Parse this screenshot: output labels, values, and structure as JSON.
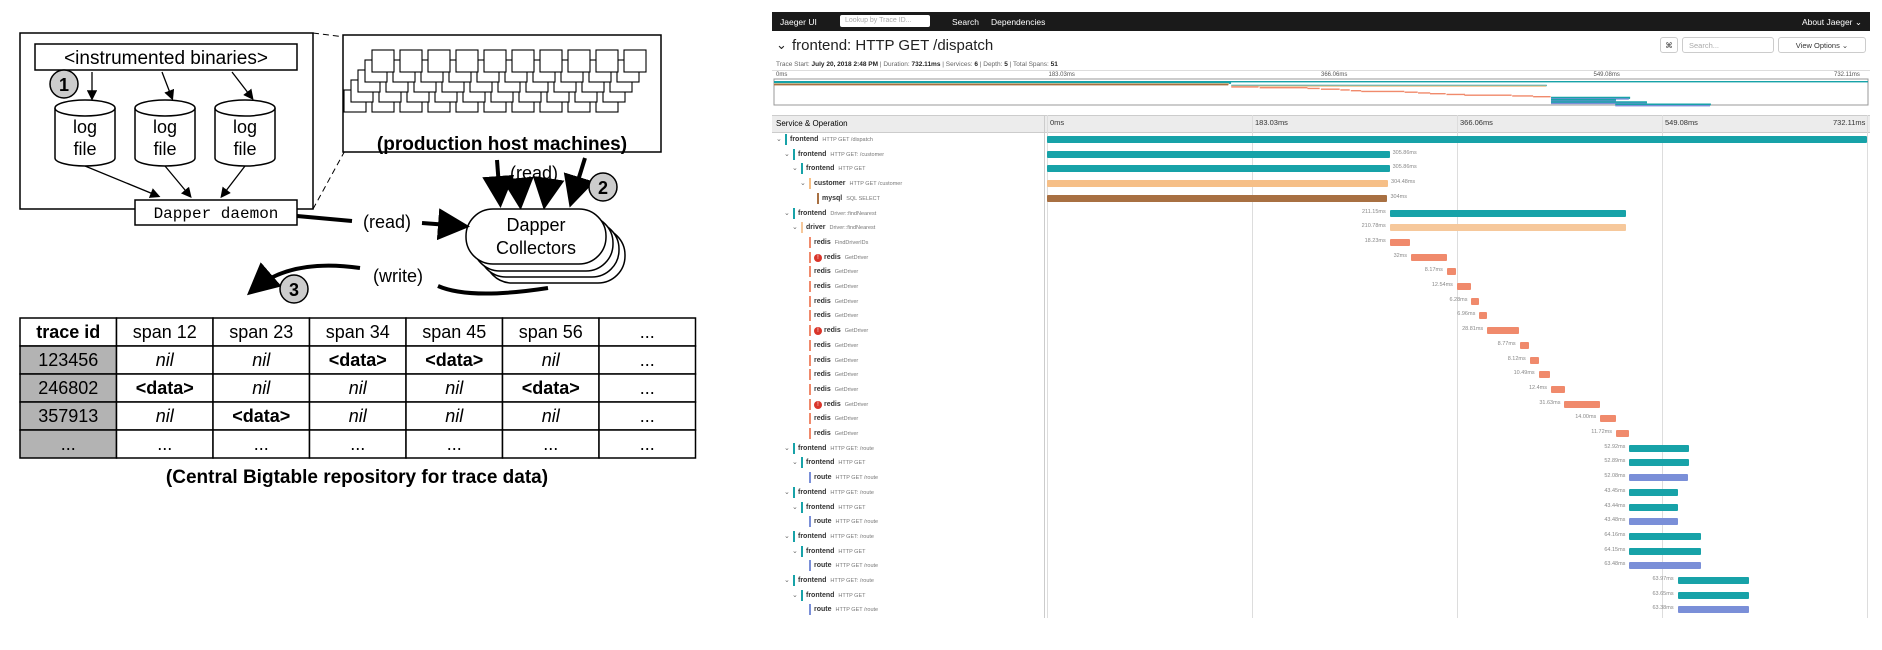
{
  "dapper": {
    "binaries_label": "<instrumented binaries>",
    "log_file_labels": [
      "log",
      "file"
    ],
    "step1": "1",
    "step2": "2",
    "step3": "3",
    "daemon_label": "Dapper daemon",
    "hosts_caption": "(production host machines)",
    "read_top": "(read)",
    "read_mid": "(read)",
    "write_label": "(write)",
    "collectors_line1": "Dapper",
    "collectors_line2": "Collectors",
    "table": {
      "headers": [
        "trace id",
        "span 12",
        "span 23",
        "span 34",
        "span 45",
        "span 56",
        "..."
      ],
      "rows": [
        [
          "123456",
          "nil",
          "nil",
          "<data>",
          "<data>",
          "nil",
          "..."
        ],
        [
          "246802",
          "<data>",
          "nil",
          "nil",
          "nil",
          "<data>",
          "..."
        ],
        [
          "357913",
          "nil",
          "<data>",
          "nil",
          "nil",
          "nil",
          "..."
        ],
        [
          "...",
          "...",
          "...",
          "...",
          "...",
          "...",
          "..."
        ]
      ]
    },
    "caption": "(Central Bigtable repository for trace data)"
  },
  "jaeger": {
    "brand": "Jaeger UI",
    "search_placeholder": "Lookup by Trace ID...",
    "nav": [
      "Search",
      "Dependencies"
    ],
    "about": "About Jaeger ⌄",
    "trace_title": "frontend: HTTP GET /dispatch",
    "meta": {
      "trace_start_label": "Trace Start:",
      "trace_start": "July 20, 2018 2:48 PM",
      "duration_label": "Duration:",
      "duration": "732.11ms",
      "services_label": "Services:",
      "services": "6",
      "depth_label": "Depth:",
      "depth": "5",
      "spans_label": "Total Spans:",
      "spans": "51"
    },
    "find_placeholder": "Search...",
    "view_options": "View Options ⌄",
    "ticks": [
      "0ms",
      "183.03ms",
      "366.06ms",
      "549.08ms",
      "732.11ms"
    ],
    "col_title": "Service & Operation",
    "total_ms": 732.11,
    "colors": {
      "frontend": "#17a2a8",
      "customer": "#f6bf87",
      "mysql": "#a87042",
      "driver": "#f6c89b",
      "redis": "#f08a6c",
      "route": "#7a8fd8"
    },
    "spans": [
      {
        "svc": "frontend",
        "op": "HTTP GET /dispatch",
        "lvl": 0,
        "caret": true,
        "start": 0,
        "dur": 732.11,
        "label": ""
      },
      {
        "svc": "frontend",
        "op": "HTTP GET: /customer",
        "lvl": 1,
        "caret": true,
        "start": 0,
        "dur": 305.86,
        "label": "305.86ms"
      },
      {
        "svc": "frontend",
        "op": "HTTP GET",
        "lvl": 2,
        "caret": true,
        "start": 0,
        "dur": 305.86,
        "label": "305.86ms"
      },
      {
        "svc": "customer",
        "op": "HTTP GET /customer",
        "lvl": 3,
        "caret": true,
        "start": 0,
        "dur": 304.48,
        "label": "304.48ms"
      },
      {
        "svc": "mysql",
        "op": "SQL SELECT",
        "lvl": 4,
        "caret": false,
        "start": 0,
        "dur": 304,
        "label": "304ms"
      },
      {
        "svc": "frontend",
        "op": "Driver::findNearest",
        "lvl": 1,
        "caret": true,
        "start": 306,
        "dur": 211.15,
        "label": "211.15ms"
      },
      {
        "svc": "driver",
        "op": "Driver::findNearest",
        "lvl": 2,
        "caret": true,
        "start": 306,
        "dur": 210.78,
        "label": "210.78ms"
      },
      {
        "svc": "redis",
        "op": "FindDriverIDs",
        "lvl": 3,
        "caret": false,
        "start": 306,
        "dur": 18.23,
        "label": "18.23ms"
      },
      {
        "svc": "redis",
        "op": "GetDriver",
        "lvl": 3,
        "caret": false,
        "err": true,
        "start": 325,
        "dur": 32,
        "label": "32ms"
      },
      {
        "svc": "redis",
        "op": "GetDriver",
        "lvl": 3,
        "caret": false,
        "start": 357,
        "dur": 8.17,
        "label": "8.17ms"
      },
      {
        "svc": "redis",
        "op": "GetDriver",
        "lvl": 3,
        "caret": false,
        "start": 366,
        "dur": 12.54,
        "label": "12.54ms"
      },
      {
        "svc": "redis",
        "op": "GetDriver",
        "lvl": 3,
        "caret": false,
        "start": 379,
        "dur": 6.28,
        "label": "6.28ms"
      },
      {
        "svc": "redis",
        "op": "GetDriver",
        "lvl": 3,
        "caret": false,
        "start": 386,
        "dur": 6.96,
        "label": "6.96ms"
      },
      {
        "svc": "redis",
        "op": "GetDriver",
        "lvl": 3,
        "caret": false,
        "err": true,
        "start": 393,
        "dur": 28.81,
        "label": "28.81ms"
      },
      {
        "svc": "redis",
        "op": "GetDriver",
        "lvl": 3,
        "caret": false,
        "start": 422,
        "dur": 8.77,
        "label": "8.77ms"
      },
      {
        "svc": "redis",
        "op": "GetDriver",
        "lvl": 3,
        "caret": false,
        "start": 431,
        "dur": 8.12,
        "label": "8.12ms"
      },
      {
        "svc": "redis",
        "op": "GetDriver",
        "lvl": 3,
        "caret": false,
        "start": 439,
        "dur": 10.49,
        "label": "10.49ms"
      },
      {
        "svc": "redis",
        "op": "GetDriver",
        "lvl": 3,
        "caret": false,
        "start": 450,
        "dur": 12.4,
        "label": "12.4ms"
      },
      {
        "svc": "redis",
        "op": "GetDriver",
        "lvl": 3,
        "caret": false,
        "err": true,
        "start": 462,
        "dur": 31.63,
        "label": "31.63ms"
      },
      {
        "svc": "redis",
        "op": "GetDriver",
        "lvl": 3,
        "caret": false,
        "start": 494,
        "dur": 14,
        "label": "14.00ms"
      },
      {
        "svc": "redis",
        "op": "GetDriver",
        "lvl": 3,
        "caret": false,
        "start": 508,
        "dur": 11.72,
        "label": "11.72ms"
      },
      {
        "svc": "frontend",
        "op": "HTTP GET: /route",
        "lvl": 1,
        "caret": true,
        "start": 520,
        "dur": 52.92,
        "label": "52.92ms"
      },
      {
        "svc": "frontend",
        "op": "HTTP GET",
        "lvl": 2,
        "caret": true,
        "start": 520,
        "dur": 52.89,
        "label": "52.89ms"
      },
      {
        "svc": "route",
        "op": "HTTP GET /route",
        "lvl": 3,
        "caret": false,
        "start": 520,
        "dur": 52.08,
        "label": "52.08ms"
      },
      {
        "svc": "frontend",
        "op": "HTTP GET: /route",
        "lvl": 1,
        "caret": true,
        "start": 520,
        "dur": 43.45,
        "label": "43.45ms"
      },
      {
        "svc": "frontend",
        "op": "HTTP GET",
        "lvl": 2,
        "caret": true,
        "start": 520,
        "dur": 43.44,
        "label": "43.44ms"
      },
      {
        "svc": "route",
        "op": "HTTP GET /route",
        "lvl": 3,
        "caret": false,
        "start": 520,
        "dur": 43.48,
        "label": "43.48ms"
      },
      {
        "svc": "frontend",
        "op": "HTTP GET: /route",
        "lvl": 1,
        "caret": true,
        "start": 520,
        "dur": 64.16,
        "label": "64.16ms"
      },
      {
        "svc": "frontend",
        "op": "HTTP GET",
        "lvl": 2,
        "caret": true,
        "start": 520,
        "dur": 64.15,
        "label": "64.15ms"
      },
      {
        "svc": "route",
        "op": "HTTP GET /route",
        "lvl": 3,
        "caret": false,
        "start": 520,
        "dur": 63.48,
        "label": "63.48ms"
      },
      {
        "svc": "frontend",
        "op": "HTTP GET: /route",
        "lvl": 1,
        "caret": true,
        "start": 563,
        "dur": 63.97,
        "label": "63.97ms"
      },
      {
        "svc": "frontend",
        "op": "HTTP GET",
        "lvl": 2,
        "caret": true,
        "start": 563,
        "dur": 63.65,
        "label": "63.65ms"
      },
      {
        "svc": "route",
        "op": "HTTP GET /route",
        "lvl": 3,
        "caret": false,
        "start": 563,
        "dur": 63.38,
        "label": "63.38ms"
      }
    ]
  }
}
